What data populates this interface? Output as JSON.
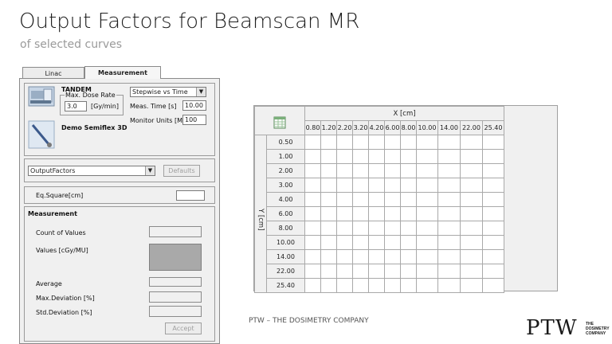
{
  "slide": {
    "title": "Output Factors for Beamscan MR",
    "subtitle": "of selected curves"
  },
  "dialog": {
    "tabs": [
      {
        "label": "Linac"
      },
      {
        "label": "Measurement"
      }
    ],
    "linac": {
      "name": "TANDEM",
      "dose_rate_label": "Max. Dose Rate",
      "dose_rate_value": "3.0",
      "dose_rate_unit": "[Gy/min]",
      "mode_select": "Stepwise vs Time",
      "meas_time_label": "Meas. Time [s]",
      "meas_time_value": "10.00",
      "monitor_units_label": "Monitor Units [MU]",
      "monitor_units_value": "100"
    },
    "detector": {
      "name": "Demo Semiflex 3D"
    },
    "analysis_select": "OutputFactors",
    "defaults_button": "Defaults",
    "eq_square_label": "Eq.Square[cm]",
    "eq_square_value": "",
    "measurement": {
      "heading": "Measurement",
      "count_label": "Count of Values",
      "values_label": "Values [cGy/MU]",
      "average_label": "Average",
      "max_dev_label": "Max.Deviation [%]",
      "std_dev_label": "Std.Deviation [%]",
      "accept_button": "Accept"
    }
  },
  "table": {
    "x_axis_label": "X [cm]",
    "y_axis_label": "Y [cm]",
    "x_values": [
      "0.80",
      "1.20",
      "2.20",
      "3.20",
      "4.20",
      "6.00",
      "8.00",
      "10.00",
      "14.00",
      "22.00",
      "25.40"
    ],
    "y_values": [
      "0.50",
      "1.00",
      "2.00",
      "3.00",
      "4.00",
      "6.00",
      "8.00",
      "10.00",
      "14.00",
      "22.00",
      "25.40"
    ]
  },
  "footer": {
    "company_text": "PTW – THE DOSIMETRY COMPANY",
    "logo_text": "PTW",
    "logo_tagline": [
      "THE",
      "DOSIMETRY",
      "COMPANY"
    ]
  },
  "icons": {
    "linac": "linac-device-icon",
    "detector": "semiflex-chamber-icon",
    "spreadsheet": "spreadsheet-icon"
  }
}
